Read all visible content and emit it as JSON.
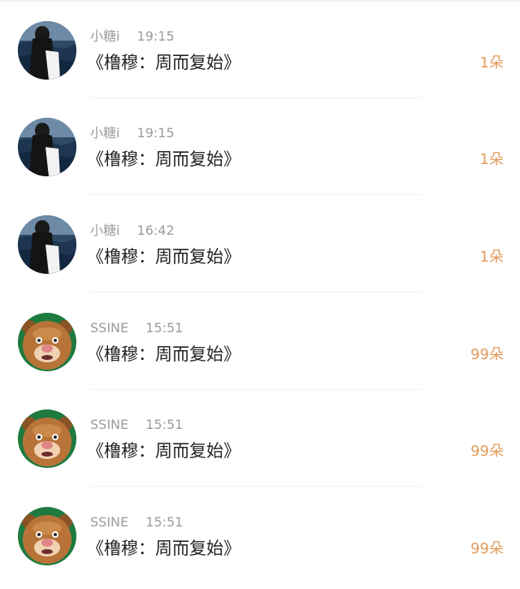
{
  "messages": [
    {
      "user": "小糖i",
      "time": "19:15",
      "text": "《橹穆：周而复始》",
      "gift": "1朵",
      "avatar": "girl-avatar"
    },
    {
      "user": "小糖i",
      "time": "19:15",
      "text": "《橹穆：周而复始》",
      "gift": "1朵",
      "avatar": "girl-avatar"
    },
    {
      "user": "小糖i",
      "time": "16:42",
      "text": "《橹穆：周而复始》",
      "gift": "1朵",
      "avatar": "girl-avatar"
    },
    {
      "user": "SSINE",
      "time": "15:51",
      "text": "《橹穆：周而复始》",
      "gift": "99朵",
      "avatar": "bear-avatar"
    },
    {
      "user": "SSINE",
      "time": "15:51",
      "text": "《橹穆：周而复始》",
      "gift": "99朵",
      "avatar": "bear-avatar"
    },
    {
      "user": "SSINE",
      "time": "15:51",
      "text": "《橹穆：周而复始》",
      "gift": "99朵",
      "avatar": "bear-avatar"
    }
  ],
  "colors": {
    "gift_accent": "#e39a5a",
    "meta_gray": "#9b9b9b",
    "message_text": "#222222"
  }
}
